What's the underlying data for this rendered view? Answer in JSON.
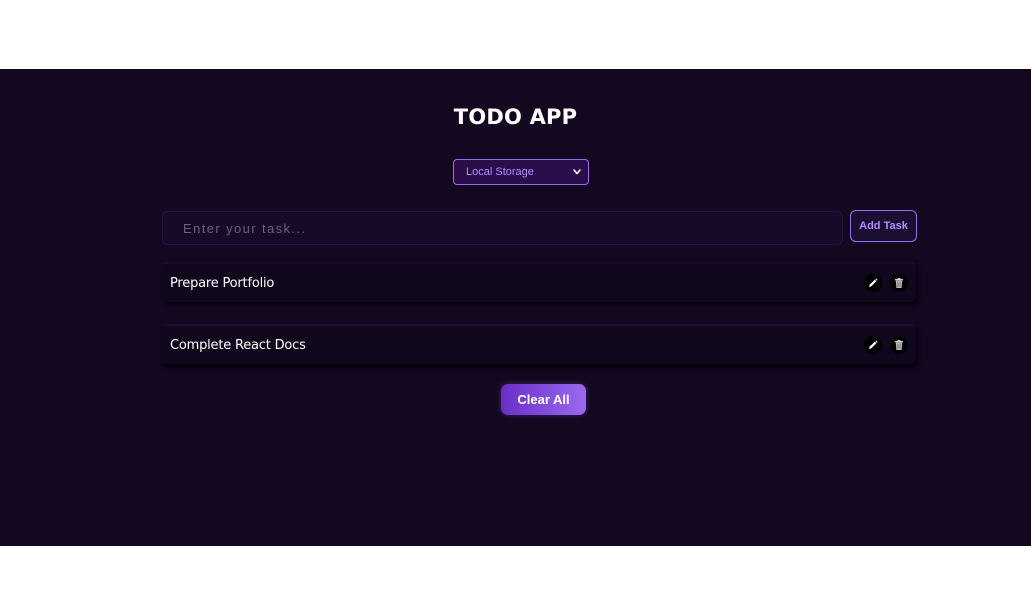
{
  "app": {
    "title": "TODO APP"
  },
  "storage_select": {
    "selected": "Local Storage"
  },
  "task_input": {
    "placeholder": "Enter your task...",
    "value": ""
  },
  "add_button": {
    "label": "Add Task"
  },
  "tasks": [
    {
      "text": "Prepare Portfolio"
    },
    {
      "text": "Complete React Docs"
    }
  ],
  "clear_button": {
    "label": "Clear All"
  },
  "icons": {
    "edit": "pencil-icon",
    "delete": "trash-icon",
    "select": "chevron-down-icon"
  },
  "colors": {
    "background": "#130820",
    "accent": "#9b6cf0",
    "accent_text": "#b48cff",
    "button_gradient_start": "#6a2ec8",
    "button_gradient_end": "#9a6af0"
  }
}
